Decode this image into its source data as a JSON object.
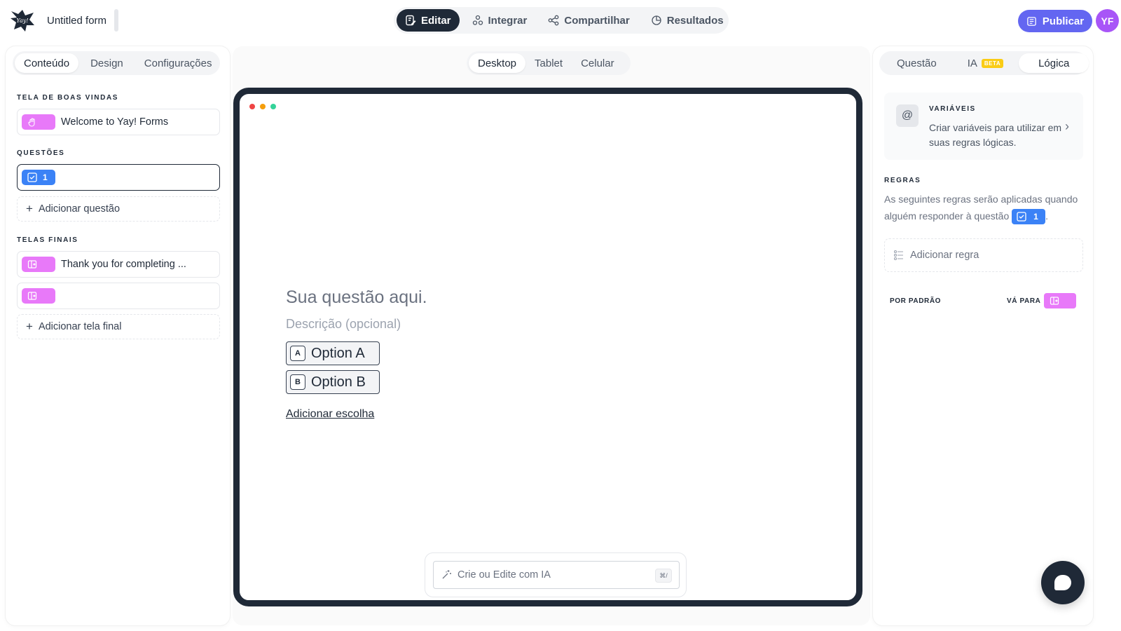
{
  "header": {
    "logo_text": "Yay!",
    "form_title": "Untitled form",
    "nav": [
      {
        "label": "Editar",
        "icon": "edit-icon"
      },
      {
        "label": "Integrar",
        "icon": "integrate-icon"
      },
      {
        "label": "Compartilhar",
        "icon": "share-icon"
      },
      {
        "label": "Resultados",
        "icon": "results-icon"
      }
    ],
    "publish_label": "Publicar",
    "avatar_initials": "YF"
  },
  "left": {
    "tabs": [
      "Conteúdo",
      "Design",
      "Configurações"
    ],
    "welcome_label": "TELA DE BOAS VINDAS",
    "welcome_item": "Welcome to Yay! Forms",
    "questions_label": "QUESTÕES",
    "question_number": "1",
    "add_question": "Adicionar questão",
    "endings_label": "TELAS FINAIS",
    "ending_item_1": "Thank you for completing ...",
    "ending_item_2": "",
    "add_ending": "Adicionar tela final"
  },
  "center": {
    "device_tabs": [
      "Desktop",
      "Tablet",
      "Celular"
    ],
    "question_title": "Sua questão aqui.",
    "question_desc": "Descrição (opcional)",
    "options": [
      {
        "key": "A",
        "label": "Option A"
      },
      {
        "key": "B",
        "label": "Option B"
      }
    ],
    "add_choice": "Adicionar escolha",
    "ai_placeholder": "Crie ou Edite com IA",
    "ai_shortcut": "⌘/"
  },
  "right": {
    "tabs": [
      "Questão",
      "IA",
      "Lógica"
    ],
    "beta_badge": "BETA",
    "variables_title": "VARIÁVEIS",
    "variables_desc": "Criar variáveis para utilizar em suas regras lógicas.",
    "rules_title": "REGRAS",
    "rules_text": "As seguintes regras serão aplicadas quando alguém responder à questão",
    "rules_question_number": "1",
    "add_rule": "Adicionar regra",
    "default_label": "POR PADRÃO",
    "goto_label": "VÁ PARA"
  },
  "colors": {
    "accent": "#6366f1",
    "dark": "#1f2937",
    "pink_tag": "#e879f9",
    "blue_tag": "#3b82f6",
    "avatar": "#a855f7",
    "beta": "#facc15",
    "dot_red": "#ef4444",
    "dot_yellow": "#f59e0b",
    "dot_green": "#34d399"
  }
}
